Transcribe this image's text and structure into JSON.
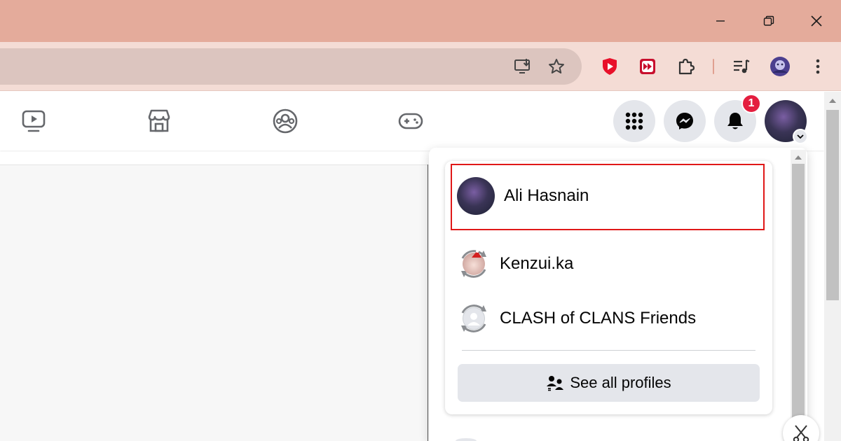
{
  "window": {
    "controls": [
      "minimize",
      "restore",
      "close"
    ]
  },
  "toolbar": {
    "omnibox_icons": [
      "install-app-icon",
      "bookmark-star-icon"
    ],
    "extensions": [
      "ublock-shield-icon",
      "video-speed-icon",
      "extensions-puzzle-icon",
      "media-playlist-icon"
    ],
    "colors": {
      "titlebar": "#e4ab9b",
      "toolbar": "#f4dcd5",
      "omnibox": "#dcc5bf"
    }
  },
  "facebook": {
    "nav_icons": [
      "watch-icon",
      "marketplace-icon",
      "groups-icon",
      "gaming-icon"
    ],
    "notification_count": "1",
    "badge_color": "#e41e3f"
  },
  "profile_switcher": {
    "current_profile": {
      "name": "Ali Hasnain"
    },
    "other_profiles": [
      {
        "name": "Kenzui.ka"
      },
      {
        "name": "CLASH of CLANS Friends"
      }
    ],
    "see_all_label": "See all profiles",
    "highlight_color": "#e01818"
  }
}
